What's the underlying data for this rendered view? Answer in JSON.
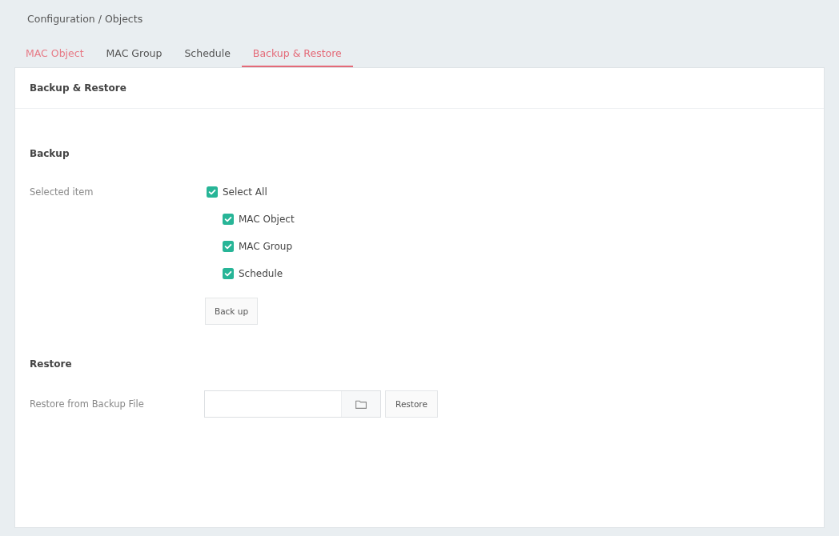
{
  "breadcrumb": "Configuration / Objects",
  "tabs": [
    {
      "label": "MAC Object",
      "selected": false,
      "hovered": true
    },
    {
      "label": "MAC Group",
      "selected": false,
      "hovered": false
    },
    {
      "label": "Schedule",
      "selected": false,
      "hovered": false
    },
    {
      "label": "Backup & Restore",
      "selected": true,
      "hovered": false
    }
  ],
  "card": {
    "title": "Backup & Restore"
  },
  "backup": {
    "heading": "Backup",
    "field_label": "Selected item",
    "checkboxes": [
      {
        "label": "Select All",
        "checked": true,
        "children": [
          {
            "label": "MAC Object",
            "checked": true
          },
          {
            "label": "MAC Group",
            "checked": true
          },
          {
            "label": "Schedule",
            "checked": true
          }
        ]
      }
    ],
    "button": "Back up"
  },
  "restore": {
    "heading": "Restore",
    "field_label": "Restore from Backup File",
    "button": "Restore"
  }
}
